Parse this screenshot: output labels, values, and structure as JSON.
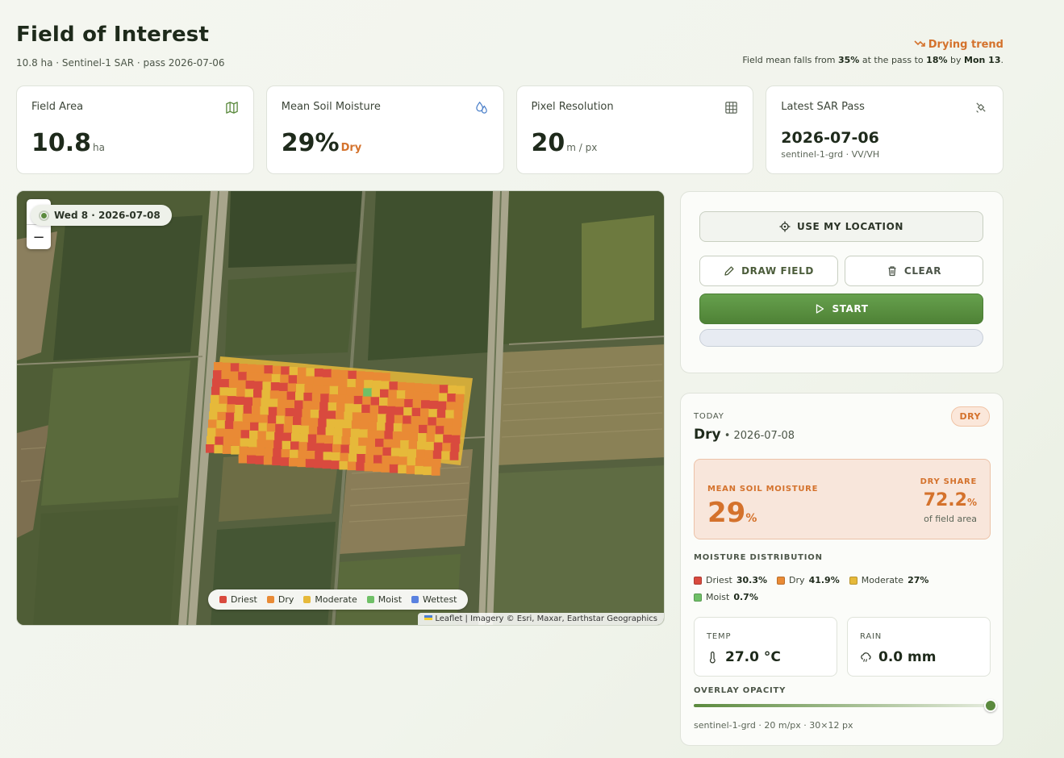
{
  "header": {
    "title": "Field of Interest",
    "subtitle": "10.8 ha · Sentinel-1 SAR · pass 2026-07-06",
    "trend": {
      "title": "Drying trend",
      "desc_prefix": "Field mean falls from ",
      "from": "35%",
      "mid": " at the pass to ",
      "to": "18%",
      "by": " by ",
      "day": "Mon 13",
      "end": "."
    }
  },
  "stats": [
    {
      "label": "Field Area",
      "value": "10.8",
      "unit": "ha",
      "icon": "map-icon"
    },
    {
      "label": "Mean Soil Moisture",
      "value": "29%",
      "status": "Dry",
      "icon": "droplets-icon"
    },
    {
      "label": "Pixel Resolution",
      "value": "20",
      "unit": "m / px",
      "icon": "grid-icon"
    },
    {
      "label": "Latest SAR Pass",
      "value": "2026-07-06",
      "meta": "sentinel-1-grd · VV/VH",
      "icon": "satellite-icon"
    }
  ],
  "map": {
    "date_pill": "Wed 8 · 2026-07-08",
    "zoom_in": "+",
    "zoom_out": "−",
    "legend": [
      {
        "label": "Driest",
        "color": "#d94a3e"
      },
      {
        "label": "Dry",
        "color": "#e98a35"
      },
      {
        "label": "Moderate",
        "color": "#e6b93a"
      },
      {
        "label": "Moist",
        "color": "#6fc067"
      },
      {
        "label": "Wettest",
        "color": "#5a82e0"
      }
    ],
    "attribution": "Leaflet | Imagery © Esri, Maxar, Earthstar Geographics"
  },
  "controls": {
    "use_location": "USE MY LOCATION",
    "draw_field": "DRAW FIELD",
    "clear": "CLEAR",
    "start": "START",
    "progress": 0
  },
  "today": {
    "label": "TODAY",
    "badge": "DRY",
    "status": "Dry",
    "date": "2026-07-08",
    "mean_label": "MEAN SOIL MOISTURE",
    "mean_value": "29",
    "mean_unit": "%",
    "dry_share_label": "DRY SHARE",
    "dry_share_value": "72.2",
    "dry_share_unit": "%",
    "dry_share_sub": "of field area",
    "dist_label": "MOISTURE DISTRIBUTION",
    "distribution": [
      {
        "label": "Driest",
        "value": "30.3%",
        "color": "#d94a3e"
      },
      {
        "label": "Dry",
        "value": "41.9%",
        "color": "#e98a35"
      },
      {
        "label": "Moderate",
        "value": "27%",
        "color": "#e6b93a"
      },
      {
        "label": "Moist",
        "value": "0.7%",
        "color": "#6fc067"
      }
    ],
    "temp_label": "TEMP",
    "temp_value": "27.0 °C",
    "rain_label": "RAIN",
    "rain_value": "0.0 mm",
    "opacity_label": "OVERLAY OPACITY",
    "opacity": 1.0,
    "footer": "sentinel-1-grd · 20 m/px · 30×12 px"
  }
}
